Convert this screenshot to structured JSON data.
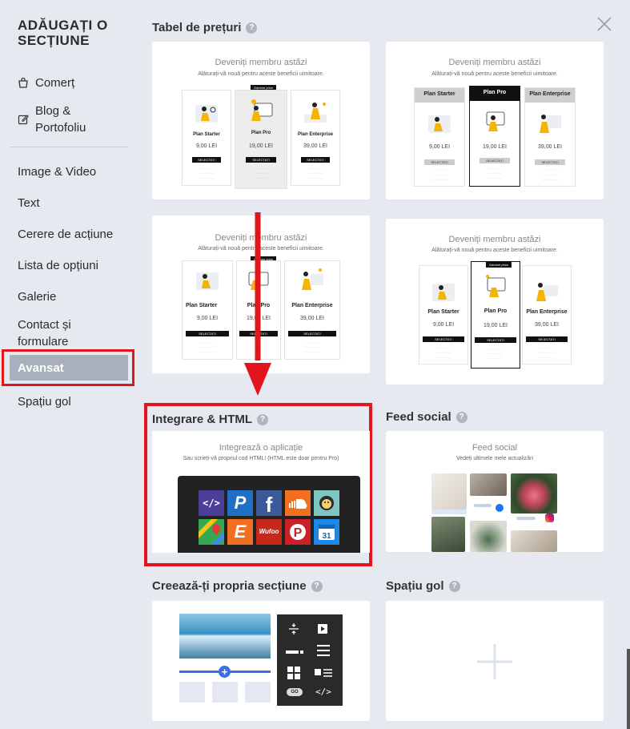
{
  "sidebar": {
    "title": "ADĂUGAȚI O SECȚIUNE",
    "items": [
      {
        "label": "Comerț"
      },
      {
        "label": "Blog & Portofoliu"
      },
      {
        "label": "Image & Video"
      },
      {
        "label": "Text"
      },
      {
        "label": "Cerere de acțiune"
      },
      {
        "label": "Lista de opțiuni"
      },
      {
        "label": "Galerie"
      },
      {
        "label": "Contact și formulare"
      },
      {
        "label": "Avansat"
      },
      {
        "label": "Spațiu gol"
      }
    ],
    "active": "Avansat",
    "highlight_color": "#e0161c"
  },
  "sections": {
    "pricing": {
      "heading": "Tabel de prețuri",
      "card_title": "Deveniți membru astăzi",
      "card_subtitle": "Alăturați-vă nouă pentru aceste beneficii uimitoare.",
      "tag": "Gamme price",
      "plans": [
        {
          "name": "Plan Starter",
          "price": "9,00 LEI"
        },
        {
          "name": "Plan Pro",
          "price": "19,00 LEI"
        },
        {
          "name": "Plan Enterprise",
          "price": "39,00 LEI"
        }
      ],
      "button": "SELECTAȚI"
    },
    "integration": {
      "heading": "Integrare & HTML",
      "card_title": "Integrează o aplicație",
      "card_subtitle": "Sau scrieți-vă propriul cod HTML! (HTML este doar pentru Pro)",
      "apps": [
        "</>",
        "P",
        "f",
        "cloud",
        "chimp",
        "map",
        "E",
        "Wufoo",
        "P",
        "31"
      ]
    },
    "feed": {
      "heading": "Feed social",
      "card_title": "Feed social",
      "card_subtitle": "Vedeți ultimele mele actualizări"
    },
    "custom": {
      "heading": "Creează-ți propria secțiune",
      "go": "GO",
      "code": "</>"
    },
    "blank": {
      "heading": "Spațiu gol"
    }
  }
}
